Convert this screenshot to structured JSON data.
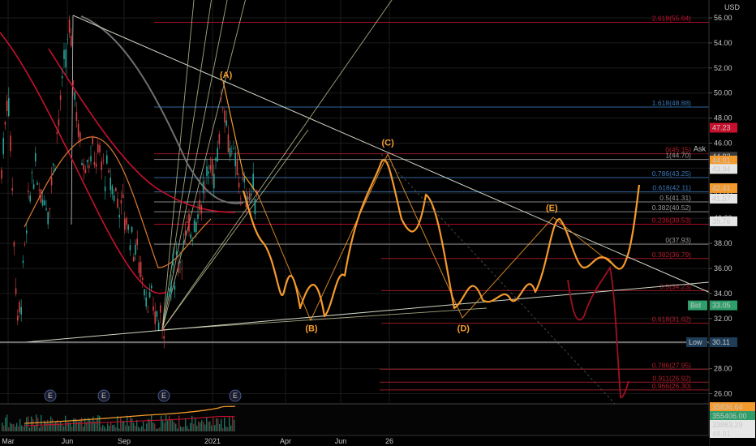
{
  "colors": {
    "background": "#000000",
    "grid": "#1b1b1b",
    "triangle_line": "#cfd8c6",
    "wave": "#f49a2c",
    "red_ma": "#c8102e",
    "gray_ma": "#707070",
    "fib_red": "#b21f2b",
    "fib_blue": "#3a7ab8",
    "fib_gray": "#9a9a9a",
    "fan": "#dcdcaa"
  },
  "axis": {
    "currency": "USD",
    "y_ticks": [
      "56.00",
      "54.00",
      "52.00",
      "50.00",
      "48.00",
      "46.00",
      "44.00",
      "42.00",
      "40.00",
      "38.00",
      "36.00",
      "34.00",
      "32.00",
      "30.00",
      "28.00",
      "26.00"
    ],
    "x_ticks": [
      "Mar",
      "Jun",
      "Sep",
      "2021",
      "Apr",
      "Jun",
      "26"
    ]
  },
  "price_tags": [
    {
      "text": "47.23",
      "bg": "#c8102e",
      "fg": "#ffffff",
      "value": 47.23
    },
    {
      "text": "Ask",
      "bg": "#000000",
      "fg": "#ffffff",
      "value": 45.55
    },
    {
      "text": "44.92",
      "bg": "#3a3a3a",
      "fg": "#e6e6e6",
      "value": 44.92
    },
    {
      "text": "44.91",
      "bg": "#f49a2c",
      "fg": "#000000",
      "value": 44.61
    },
    {
      "text": "43.94",
      "bg": "#e6e6e6",
      "fg": "#000000",
      "value": 43.94
    },
    {
      "text": "42.41",
      "bg": "#f49a2c",
      "fg": "#000000",
      "value": 42.41
    },
    {
      "text": "41.57",
      "bg": "#e6e6e6",
      "fg": "#000000",
      "value": 41.57
    },
    {
      "text": "39.76",
      "bg": "#e6e6e6",
      "fg": "#000000",
      "value": 39.76
    },
    {
      "text": "Bid",
      "bg": "#2e9e6a",
      "fg": "#ffffff",
      "value": 33.05
    },
    {
      "text": "33.05",
      "bg": "#2e9e6a",
      "fg": "#ffffff",
      "value": 33.05
    },
    {
      "text": "Low",
      "bg": "#1f3d57",
      "fg": "#ffffff",
      "value": 30.11
    },
    {
      "text": "30.11",
      "bg": "#1f3d57",
      "fg": "#ffffff",
      "value": 30.11
    }
  ],
  "volume_tags": [
    {
      "text": "35836.64",
      "bg": "#f49a2c",
      "fg": "#000000"
    },
    {
      "text": "355406.00",
      "bg": "#2e9e6a",
      "fg": "#ffffff"
    },
    {
      "text": "33883.29",
      "bg": "#e6e6e6",
      "fg": "#000000"
    },
    {
      "text": "48.91",
      "bg": "#e6e6e6",
      "fg": "#000000"
    }
  ],
  "earnings_markers": [
    "E",
    "E",
    "E",
    "E"
  ],
  "chart_data": {
    "type": "line",
    "ylim": [
      24.5,
      57.5
    ],
    "fib_levels": [
      {
        "label": "2.618(55.64)",
        "value": 55.64,
        "color": "#c8102e"
      },
      {
        "label": "1.618(48.88)",
        "value": 48.88,
        "color": "#3a7ab8"
      },
      {
        "label": "0(45.15)",
        "value": 45.15,
        "color": "#b21f2b"
      },
      {
        "label": "1(44.70)",
        "value": 44.7,
        "color": "#9a9a9a"
      },
      {
        "label": "0.786(43.25)",
        "value": 43.25,
        "color": "#3a7ab8"
      },
      {
        "label": "0.618(42.11)",
        "value": 42.11,
        "color": "#3a7ab8"
      },
      {
        "label": "0.5(41.31)",
        "value": 41.31,
        "color": "#9a9a9a"
      },
      {
        "label": "0.382(40.52)",
        "value": 40.52,
        "color": "#9a9a9a"
      },
      {
        "label": "0.236(39.53)",
        "value": 39.53,
        "color": "#c8102e"
      },
      {
        "label": "0(37.93)",
        "value": 37.93,
        "color": "#9a9a9a"
      },
      {
        "label": "0.382(36.79)",
        "value": 36.79,
        "color": "#b21f2b"
      },
      {
        "label": "0.5(34.23)",
        "value": 34.23,
        "color": "#b21f2b"
      },
      {
        "label": "0.618(31.62)",
        "value": 31.62,
        "color": "#b21f2b"
      },
      {
        "label": "0.786(27.95)",
        "value": 27.95,
        "color": "#b21f2b"
      },
      {
        "label": "0.911(26.92)",
        "value": 26.92,
        "color": "#b21f2b"
      },
      {
        "label": "0.966(26.30)",
        "value": 26.3,
        "color": "#b21f2b"
      }
    ],
    "wave_labels": [
      {
        "label": "(A)",
        "x": 0.299,
        "value": 51.2
      },
      {
        "label": "(B)",
        "x": 0.412,
        "value": 31.0
      },
      {
        "label": "(C)",
        "x": 0.513,
        "value": 45.8
      },
      {
        "label": "(D)",
        "x": 0.613,
        "value": 31.0
      },
      {
        "label": "(E)",
        "x": 0.73,
        "value": 40.6
      }
    ]
  }
}
